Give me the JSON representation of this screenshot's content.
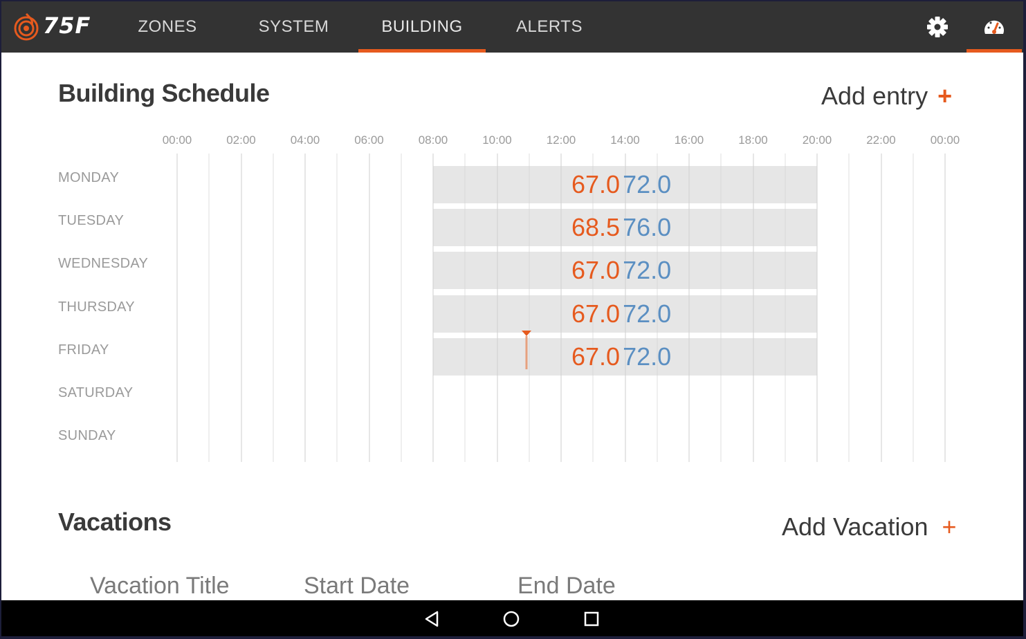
{
  "app": {
    "logo_text": "75F",
    "colors": {
      "accent": "#e65a1e",
      "heating": "#e65a1e",
      "cooling": "#5b8fc2",
      "topbar": "#333333"
    }
  },
  "nav": {
    "tabs": [
      {
        "label": "ZONES",
        "active": false
      },
      {
        "label": "SYSTEM",
        "active": false
      },
      {
        "label": "BUILDING",
        "active": true
      },
      {
        "label": "ALERTS",
        "active": false
      }
    ],
    "icons": [
      "gear-icon",
      "gauge-icon"
    ]
  },
  "schedule": {
    "title": "Building Schedule",
    "add_label": "Add entry",
    "add_symbol": "+",
    "hours": [
      "00:00",
      "02:00",
      "04:00",
      "06:00",
      "08:00",
      "10:00",
      "12:00",
      "14:00",
      "16:00",
      "18:00",
      "20:00",
      "22:00",
      "00:00"
    ],
    "days": [
      "MONDAY",
      "TUESDAY",
      "WEDNESDAY",
      "THURSDAY",
      "FRIDAY",
      "SATURDAY",
      "SUNDAY"
    ],
    "entries": [
      {
        "day": "MONDAY",
        "start": "08:00",
        "end": "20:00",
        "heat": "67.0",
        "cool": "72.0"
      },
      {
        "day": "TUESDAY",
        "start": "08:00",
        "end": "20:00",
        "heat": "68.5",
        "cool": "76.0"
      },
      {
        "day": "WEDNESDAY",
        "start": "08:00",
        "end": "20:00",
        "heat": "67.0",
        "cool": "72.0"
      },
      {
        "day": "THURSDAY",
        "start": "08:00",
        "end": "20:00",
        "heat": "67.0",
        "cool": "72.0"
      },
      {
        "day": "FRIDAY",
        "start": "08:00",
        "end": "20:00",
        "heat": "67.0",
        "cool": "72.0"
      }
    ]
  },
  "vacations": {
    "title": "Vacations",
    "add_label": "Add Vacation",
    "add_symbol": "+",
    "columns": [
      "Vacation Title",
      "Start Date",
      "End Date"
    ]
  },
  "system_nav": {
    "icons": [
      "back-icon",
      "home-icon",
      "recents-icon"
    ]
  }
}
